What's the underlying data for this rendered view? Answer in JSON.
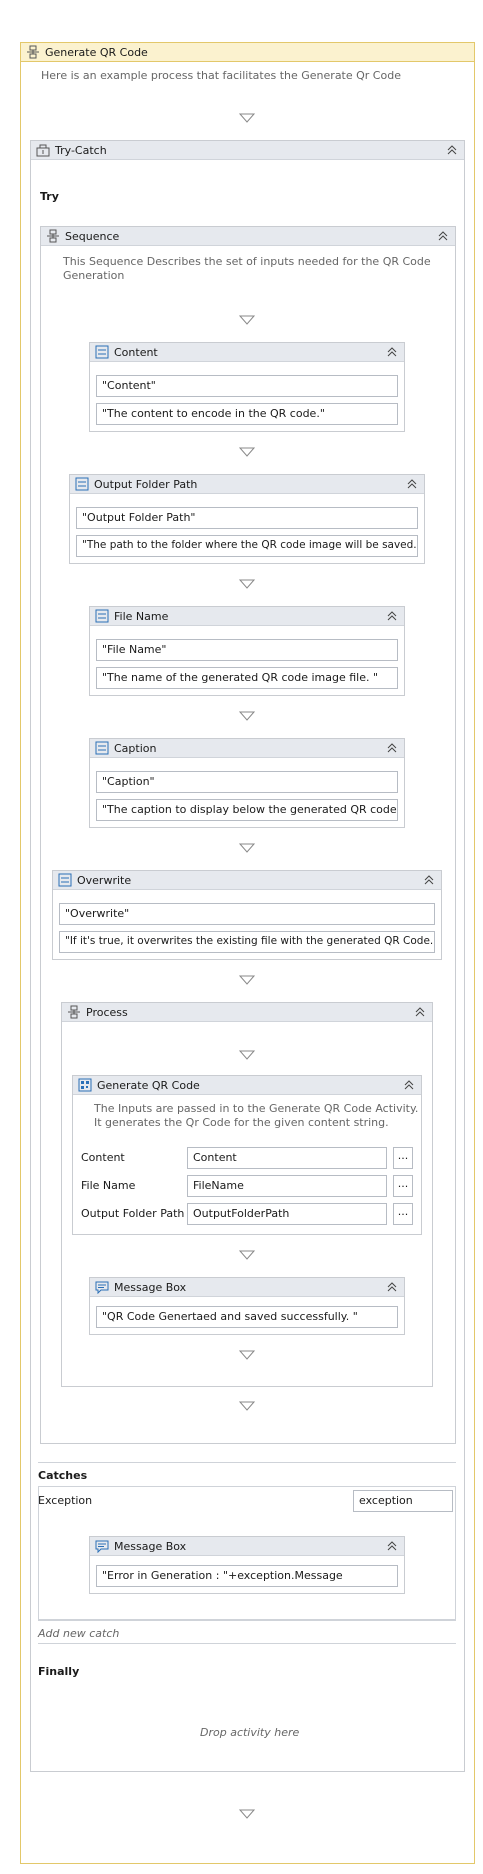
{
  "workflow": {
    "title": "Generate QR Code",
    "description": "Here is an example process that facilitates the Generate Qr Code"
  },
  "try_catch": {
    "title": "Try-Catch",
    "try_label": "Try",
    "catches_label": "Catches",
    "exception_label": "Exception",
    "exception_var": "exception",
    "add_catch": "Add new catch",
    "finally_label": "Finally",
    "drop_hint": "Drop activity here"
  },
  "sequence": {
    "title": "Sequence",
    "description_line1": "This Sequence Describes the set of inputs needed for the QR Code",
    "description_line2": "Generation"
  },
  "args": [
    {
      "title": "Content",
      "name": "\"Content\"",
      "desc": "\"The content to encode in the QR code.\""
    },
    {
      "title": "Output Folder Path",
      "name": "\"Output Folder Path\"",
      "desc": "\"The path to the folder where the QR code image will be saved.\""
    },
    {
      "title": "File Name",
      "name": "\"File Name\"",
      "desc": "\"The name of the generated QR code image file. \""
    },
    {
      "title": "Caption",
      "name": "\"Caption\"",
      "desc": "\"The caption to display below the generated QR code. \""
    },
    {
      "title": "Overwrite",
      "name": "\"Overwrite\"",
      "desc": "\"If it's true, it overwrites the existing file with the generated QR Code.\""
    }
  ],
  "process": {
    "title": "Process",
    "gen": {
      "title": "Generate QR Code",
      "desc_line1": "The Inputs are passed in to the Generate QR Code Activity.",
      "desc_line2": "It generates the Qr Code for the given content string.",
      "props": [
        {
          "label": "Content",
          "value": "Content"
        },
        {
          "label": "File Name",
          "value": "FileName"
        },
        {
          "label": "Output Folder Path",
          "value": "OutputFolderPath"
        }
      ],
      "ellipsis": "..."
    },
    "msg": {
      "title": "Message Box",
      "text": "\"QR Code Genertaed and saved successfully. \""
    }
  },
  "catch_msg": {
    "title": "Message Box",
    "text": "\"Error in Generation : \"+exception.Message"
  },
  "colors": {
    "header_main": "#fbf2cf",
    "header": "#e6e9ee",
    "border": "#c9ccd1",
    "icon_blue": "#2a6fb7"
  }
}
